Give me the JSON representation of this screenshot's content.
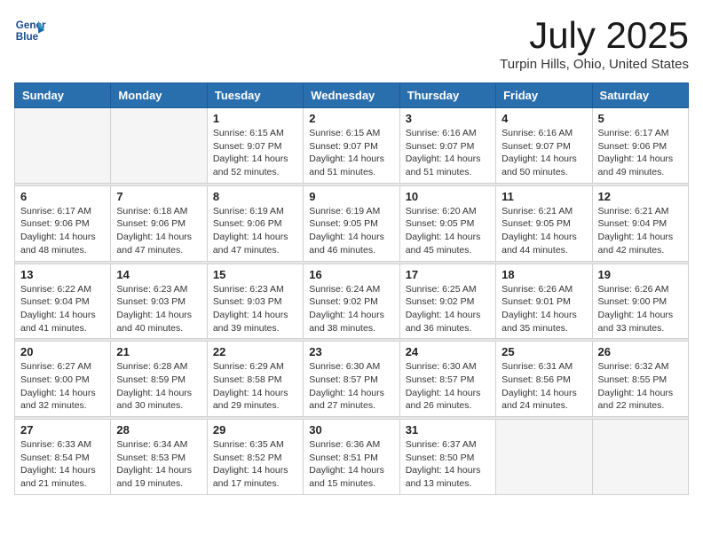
{
  "header": {
    "logo_line1": "General",
    "logo_line2": "Blue",
    "month_title": "July 2025",
    "location": "Turpin Hills, Ohio, United States"
  },
  "weekdays": [
    "Sunday",
    "Monday",
    "Tuesday",
    "Wednesday",
    "Thursday",
    "Friday",
    "Saturday"
  ],
  "weeks": [
    [
      {
        "day": "",
        "sunrise": "",
        "sunset": "",
        "daylight": ""
      },
      {
        "day": "",
        "sunrise": "",
        "sunset": "",
        "daylight": ""
      },
      {
        "day": "1",
        "sunrise": "Sunrise: 6:15 AM",
        "sunset": "Sunset: 9:07 PM",
        "daylight": "Daylight: 14 hours and 52 minutes."
      },
      {
        "day": "2",
        "sunrise": "Sunrise: 6:15 AM",
        "sunset": "Sunset: 9:07 PM",
        "daylight": "Daylight: 14 hours and 51 minutes."
      },
      {
        "day": "3",
        "sunrise": "Sunrise: 6:16 AM",
        "sunset": "Sunset: 9:07 PM",
        "daylight": "Daylight: 14 hours and 51 minutes."
      },
      {
        "day": "4",
        "sunrise": "Sunrise: 6:16 AM",
        "sunset": "Sunset: 9:07 PM",
        "daylight": "Daylight: 14 hours and 50 minutes."
      },
      {
        "day": "5",
        "sunrise": "Sunrise: 6:17 AM",
        "sunset": "Sunset: 9:06 PM",
        "daylight": "Daylight: 14 hours and 49 minutes."
      }
    ],
    [
      {
        "day": "6",
        "sunrise": "Sunrise: 6:17 AM",
        "sunset": "Sunset: 9:06 PM",
        "daylight": "Daylight: 14 hours and 48 minutes."
      },
      {
        "day": "7",
        "sunrise": "Sunrise: 6:18 AM",
        "sunset": "Sunset: 9:06 PM",
        "daylight": "Daylight: 14 hours and 47 minutes."
      },
      {
        "day": "8",
        "sunrise": "Sunrise: 6:19 AM",
        "sunset": "Sunset: 9:06 PM",
        "daylight": "Daylight: 14 hours and 47 minutes."
      },
      {
        "day": "9",
        "sunrise": "Sunrise: 6:19 AM",
        "sunset": "Sunset: 9:05 PM",
        "daylight": "Daylight: 14 hours and 46 minutes."
      },
      {
        "day": "10",
        "sunrise": "Sunrise: 6:20 AM",
        "sunset": "Sunset: 9:05 PM",
        "daylight": "Daylight: 14 hours and 45 minutes."
      },
      {
        "day": "11",
        "sunrise": "Sunrise: 6:21 AM",
        "sunset": "Sunset: 9:05 PM",
        "daylight": "Daylight: 14 hours and 44 minutes."
      },
      {
        "day": "12",
        "sunrise": "Sunrise: 6:21 AM",
        "sunset": "Sunset: 9:04 PM",
        "daylight": "Daylight: 14 hours and 42 minutes."
      }
    ],
    [
      {
        "day": "13",
        "sunrise": "Sunrise: 6:22 AM",
        "sunset": "Sunset: 9:04 PM",
        "daylight": "Daylight: 14 hours and 41 minutes."
      },
      {
        "day": "14",
        "sunrise": "Sunrise: 6:23 AM",
        "sunset": "Sunset: 9:03 PM",
        "daylight": "Daylight: 14 hours and 40 minutes."
      },
      {
        "day": "15",
        "sunrise": "Sunrise: 6:23 AM",
        "sunset": "Sunset: 9:03 PM",
        "daylight": "Daylight: 14 hours and 39 minutes."
      },
      {
        "day": "16",
        "sunrise": "Sunrise: 6:24 AM",
        "sunset": "Sunset: 9:02 PM",
        "daylight": "Daylight: 14 hours and 38 minutes."
      },
      {
        "day": "17",
        "sunrise": "Sunrise: 6:25 AM",
        "sunset": "Sunset: 9:02 PM",
        "daylight": "Daylight: 14 hours and 36 minutes."
      },
      {
        "day": "18",
        "sunrise": "Sunrise: 6:26 AM",
        "sunset": "Sunset: 9:01 PM",
        "daylight": "Daylight: 14 hours and 35 minutes."
      },
      {
        "day": "19",
        "sunrise": "Sunrise: 6:26 AM",
        "sunset": "Sunset: 9:00 PM",
        "daylight": "Daylight: 14 hours and 33 minutes."
      }
    ],
    [
      {
        "day": "20",
        "sunrise": "Sunrise: 6:27 AM",
        "sunset": "Sunset: 9:00 PM",
        "daylight": "Daylight: 14 hours and 32 minutes."
      },
      {
        "day": "21",
        "sunrise": "Sunrise: 6:28 AM",
        "sunset": "Sunset: 8:59 PM",
        "daylight": "Daylight: 14 hours and 30 minutes."
      },
      {
        "day": "22",
        "sunrise": "Sunrise: 6:29 AM",
        "sunset": "Sunset: 8:58 PM",
        "daylight": "Daylight: 14 hours and 29 minutes."
      },
      {
        "day": "23",
        "sunrise": "Sunrise: 6:30 AM",
        "sunset": "Sunset: 8:57 PM",
        "daylight": "Daylight: 14 hours and 27 minutes."
      },
      {
        "day": "24",
        "sunrise": "Sunrise: 6:30 AM",
        "sunset": "Sunset: 8:57 PM",
        "daylight": "Daylight: 14 hours and 26 minutes."
      },
      {
        "day": "25",
        "sunrise": "Sunrise: 6:31 AM",
        "sunset": "Sunset: 8:56 PM",
        "daylight": "Daylight: 14 hours and 24 minutes."
      },
      {
        "day": "26",
        "sunrise": "Sunrise: 6:32 AM",
        "sunset": "Sunset: 8:55 PM",
        "daylight": "Daylight: 14 hours and 22 minutes."
      }
    ],
    [
      {
        "day": "27",
        "sunrise": "Sunrise: 6:33 AM",
        "sunset": "Sunset: 8:54 PM",
        "daylight": "Daylight: 14 hours and 21 minutes."
      },
      {
        "day": "28",
        "sunrise": "Sunrise: 6:34 AM",
        "sunset": "Sunset: 8:53 PM",
        "daylight": "Daylight: 14 hours and 19 minutes."
      },
      {
        "day": "29",
        "sunrise": "Sunrise: 6:35 AM",
        "sunset": "Sunset: 8:52 PM",
        "daylight": "Daylight: 14 hours and 17 minutes."
      },
      {
        "day": "30",
        "sunrise": "Sunrise: 6:36 AM",
        "sunset": "Sunset: 8:51 PM",
        "daylight": "Daylight: 14 hours and 15 minutes."
      },
      {
        "day": "31",
        "sunrise": "Sunrise: 6:37 AM",
        "sunset": "Sunset: 8:50 PM",
        "daylight": "Daylight: 14 hours and 13 minutes."
      },
      {
        "day": "",
        "sunrise": "",
        "sunset": "",
        "daylight": ""
      },
      {
        "day": "",
        "sunrise": "",
        "sunset": "",
        "daylight": ""
      }
    ]
  ]
}
